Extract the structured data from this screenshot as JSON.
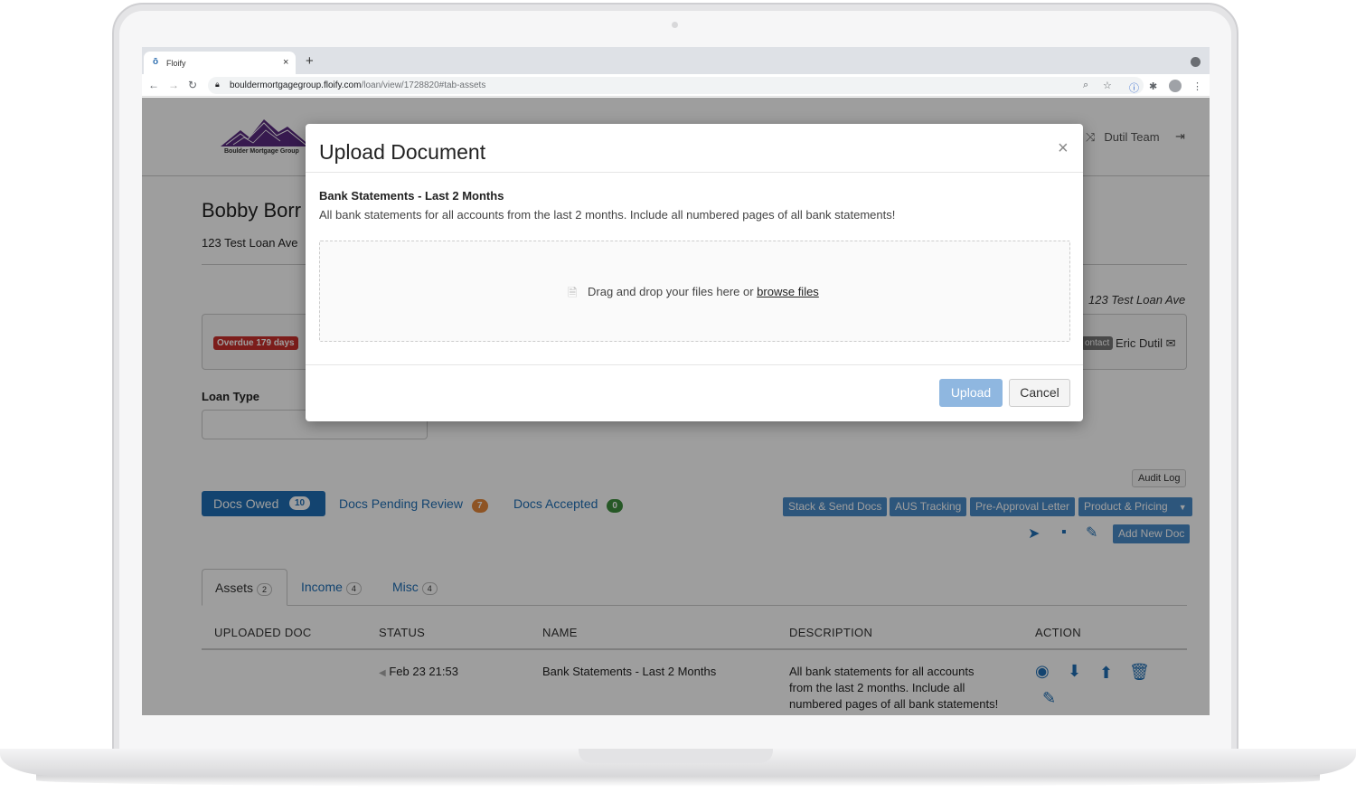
{
  "browser": {
    "tab_title": "Floify",
    "tab_close": "×",
    "new_tab": "+",
    "url_domain": "bouldermortgagegroup.floify.com",
    "url_path": "/loan/view/1728820#tab-assets"
  },
  "header": {
    "logo_text": "Boulder Mortgage Group",
    "team": "Dutil Team"
  },
  "loan": {
    "borrower": "Bobby Borr",
    "address": "123 Test Loan Ave",
    "address_right": "123 Test Loan Ave",
    "overdue_badge": "Overdue 179 days",
    "contact_label": "ontact",
    "contact_name": "Eric Dutil",
    "loan_type_label": "Loan Type"
  },
  "actions": {
    "audit_log": "Audit Log",
    "stack_send": "Stack & Send Docs",
    "aus_tracking": "AUS Tracking",
    "pre_approval": "Pre-Approval Letter",
    "product_pricing": "Product & Pricing",
    "add_new_doc": "Add New Doc"
  },
  "pills": {
    "owed_label": "Docs Owed",
    "owed_count": "10",
    "pending_label": "Docs Pending Review",
    "pending_count": "7",
    "accepted_label": "Docs Accepted",
    "accepted_count": "0"
  },
  "subtabs": {
    "assets_label": "Assets",
    "assets_count": "2",
    "income_label": "Income",
    "income_count": "4",
    "misc_label": "Misc",
    "misc_count": "4"
  },
  "table": {
    "headers": [
      "UPLOADED DOC",
      "STATUS",
      "NAME",
      "DESCRIPTION",
      "ACTION"
    ],
    "row": {
      "status": "Feb 23 21:53",
      "name": "Bank Statements - Last 2 Months",
      "description_1": "All bank statements for all accounts",
      "description_2": "from the last 2 months. Include all",
      "description_3": "numbered pages of all bank statements!"
    }
  },
  "modal": {
    "title": "Upload Document",
    "close": "×",
    "doc_title": "Bank Statements - Last 2 Months",
    "doc_description": "All bank statements for all accounts from the last 2 months. Include all numbered pages of all bank statements!",
    "dropzone_text": "Drag and drop your files here or",
    "dropzone_link": "browse files",
    "upload_label": "Upload",
    "cancel_label": "Cancel"
  },
  "colors": {
    "accent": "#1f6fb5",
    "upload_disabled": "#8fb7e0",
    "overdue": "#c9302c"
  }
}
